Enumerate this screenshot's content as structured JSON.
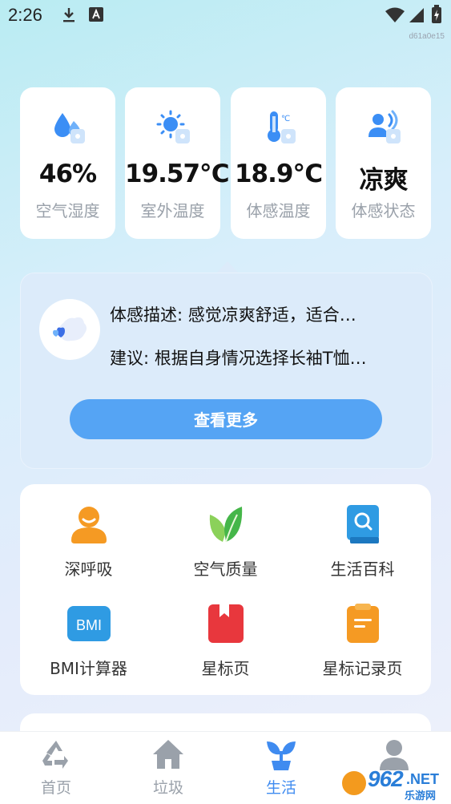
{
  "status_bar": {
    "time": "2:26",
    "icons": [
      "download-icon",
      "a-icon",
      "wifi-icon",
      "signal-icon",
      "battery-icon"
    ]
  },
  "watermark_id": "d61a0e15",
  "stats": [
    {
      "icon": "humidity-icon",
      "value": "46%",
      "label": "空气湿度"
    },
    {
      "icon": "sun-icon",
      "value": "19.57℃",
      "label": "室外温度"
    },
    {
      "icon": "thermometer-icon",
      "value": "18.9℃",
      "label": "体感温度"
    },
    {
      "icon": "person-wave-icon",
      "value": "凉爽",
      "label": "体感状态"
    }
  ],
  "description": {
    "line1": "体感描述: 感觉凉爽舒适，适合…",
    "line2": "建议: 根据自身情况选择长袖T恤…",
    "more_button": "查看更多"
  },
  "tools": [
    {
      "icon": "breathing-icon",
      "label": "深呼吸"
    },
    {
      "icon": "leaf-icon",
      "label": "空气质量"
    },
    {
      "icon": "book-search-icon",
      "label": "生活百科"
    },
    {
      "icon": "bmi-icon",
      "label": "BMI计算器",
      "icon_text": "BMI"
    },
    {
      "icon": "bookmark-icon",
      "label": "星标页"
    },
    {
      "icon": "notes-icon",
      "label": "星标记录页"
    }
  ],
  "nav": [
    {
      "icon": "recycle-icon",
      "label": "首页"
    },
    {
      "icon": "home-icon",
      "label": "垃圾"
    },
    {
      "icon": "plant-icon",
      "label": "生活",
      "active": true
    },
    {
      "icon": "user-icon",
      "label": ""
    }
  ],
  "site_logo": {
    "number": "962",
    "suffix": ".NET",
    "cn": "乐游网"
  },
  "colors": {
    "accent": "#55a4f4",
    "active_nav": "#3f8bf0",
    "desc_bg": "#dcebfa"
  }
}
